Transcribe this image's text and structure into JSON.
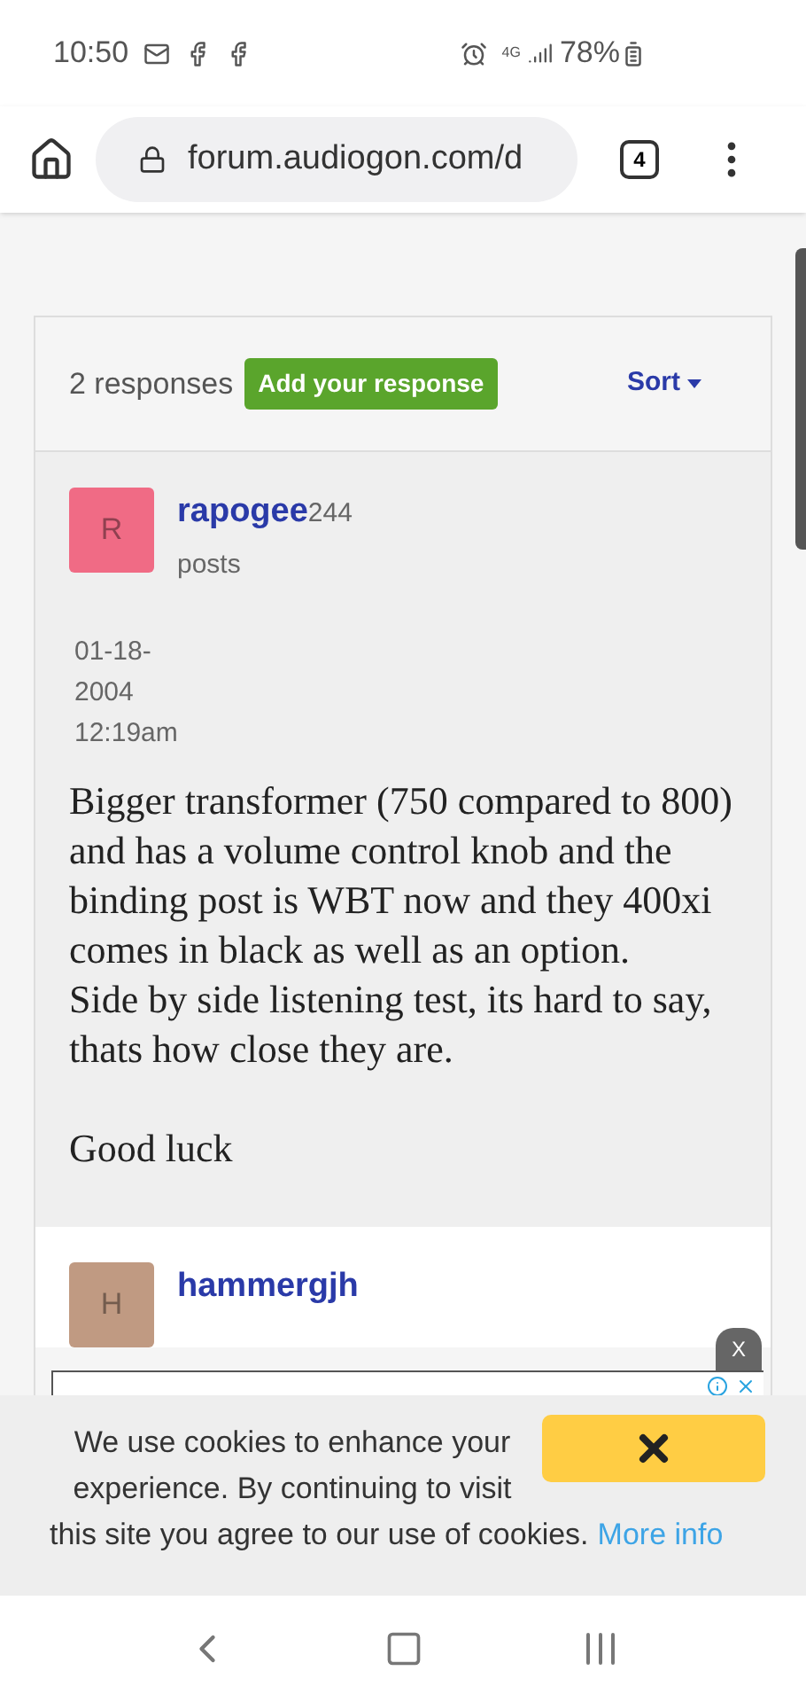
{
  "status_bar": {
    "time": "10:50",
    "network": "4G",
    "battery": "78%"
  },
  "browser": {
    "url": "forum.audiogon.com/d",
    "tab_count": "4"
  },
  "responses": {
    "count": "2 responses",
    "add_button": "Add your response",
    "sort": "Sort"
  },
  "posts": [
    {
      "initial": "R",
      "color": "#f06b85",
      "user": "rapogee",
      "post_count": "244",
      "posts_label": "posts",
      "date_lines": [
        "01-18-",
        "2004",
        "12:19am"
      ],
      "paragraphs": [
        "Bigger transformer (750 compared to 800) and has a volume control knob and the binding post is WBT now and they 400xi comes in black as well as an option.\nSide by side listening test, its hard to say, thats how close they are.",
        "Good luck"
      ]
    },
    {
      "initial": "H",
      "color": "#c09a82",
      "user": "hammergjh"
    }
  ],
  "ad": {
    "close": "X"
  },
  "cookie_banner": {
    "text_lines": [
      "We use cookies to enhance your experience. By continuing to visit",
      "this site you agree to our use of cookies."
    ],
    "link": "More info"
  }
}
